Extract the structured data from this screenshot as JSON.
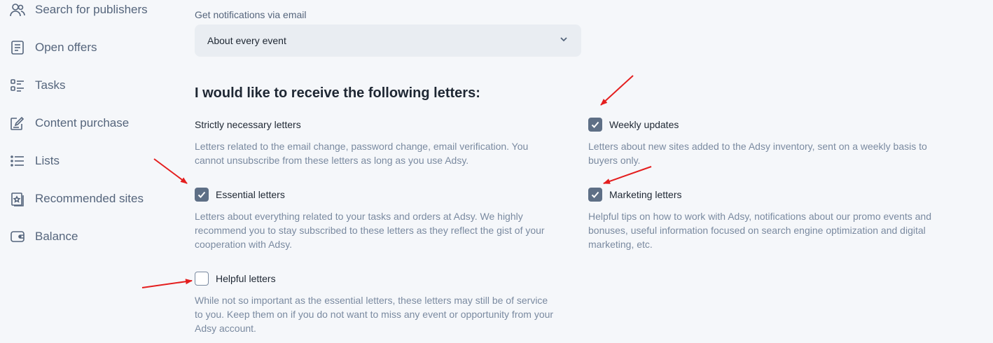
{
  "sidebar": {
    "items": [
      {
        "label": "Search for publishers",
        "icon": "users-icon"
      },
      {
        "label": "Open offers",
        "icon": "document-icon"
      },
      {
        "label": "Tasks",
        "icon": "task-list-icon"
      },
      {
        "label": "Content purchase",
        "icon": "edit-document-icon"
      },
      {
        "label": "Lists",
        "icon": "list-icon"
      },
      {
        "label": "Recommended sites",
        "icon": "star-bookmark-icon"
      },
      {
        "label": "Balance",
        "icon": "wallet-icon"
      }
    ]
  },
  "notifications": {
    "label": "Get notifications via email",
    "selected": "About every event"
  },
  "letters": {
    "heading": "I would like to receive the following letters:",
    "strictly": {
      "title": "Strictly necessary letters",
      "desc_lines": [
        "Letters related to the email change, password change, email verification. You",
        "cannot unsubscribe from these letters as long as you use Adsy."
      ]
    },
    "essential": {
      "title": "Essential letters",
      "checked": true,
      "desc_lines": [
        "Letters about everything related to your tasks and orders at Adsy. We highly",
        "recommend you to stay subscribed to these letters as they reflect the gist of your",
        "cooperation with Adsy."
      ]
    },
    "helpful": {
      "title": "Helpful letters",
      "checked": false,
      "desc_lines": [
        "While not so important as the essential letters, these letters may still be of service",
        "to you. Keep them on if you do not want to miss any event or opportunity from your",
        "Adsy account."
      ]
    },
    "weekly": {
      "title": "Weekly updates",
      "checked": true,
      "desc_lines": [
        "Letters about new sites added to the Adsy inventory, sent on a weekly basis to",
        "buyers only."
      ]
    },
    "marketing": {
      "title": "Marketing letters",
      "checked": true,
      "desc_lines": [
        "Helpful tips on how to work with Adsy, notifications about our promo events and",
        "bonuses, useful information focused on search engine optimization and digital",
        "marketing, etc."
      ]
    }
  },
  "colors": {
    "background": "#f5f7fa",
    "checkbox_checked": "#5e6f86",
    "annotation_arrow": "#e41e1e",
    "muted_text": "#7a8aa0"
  }
}
